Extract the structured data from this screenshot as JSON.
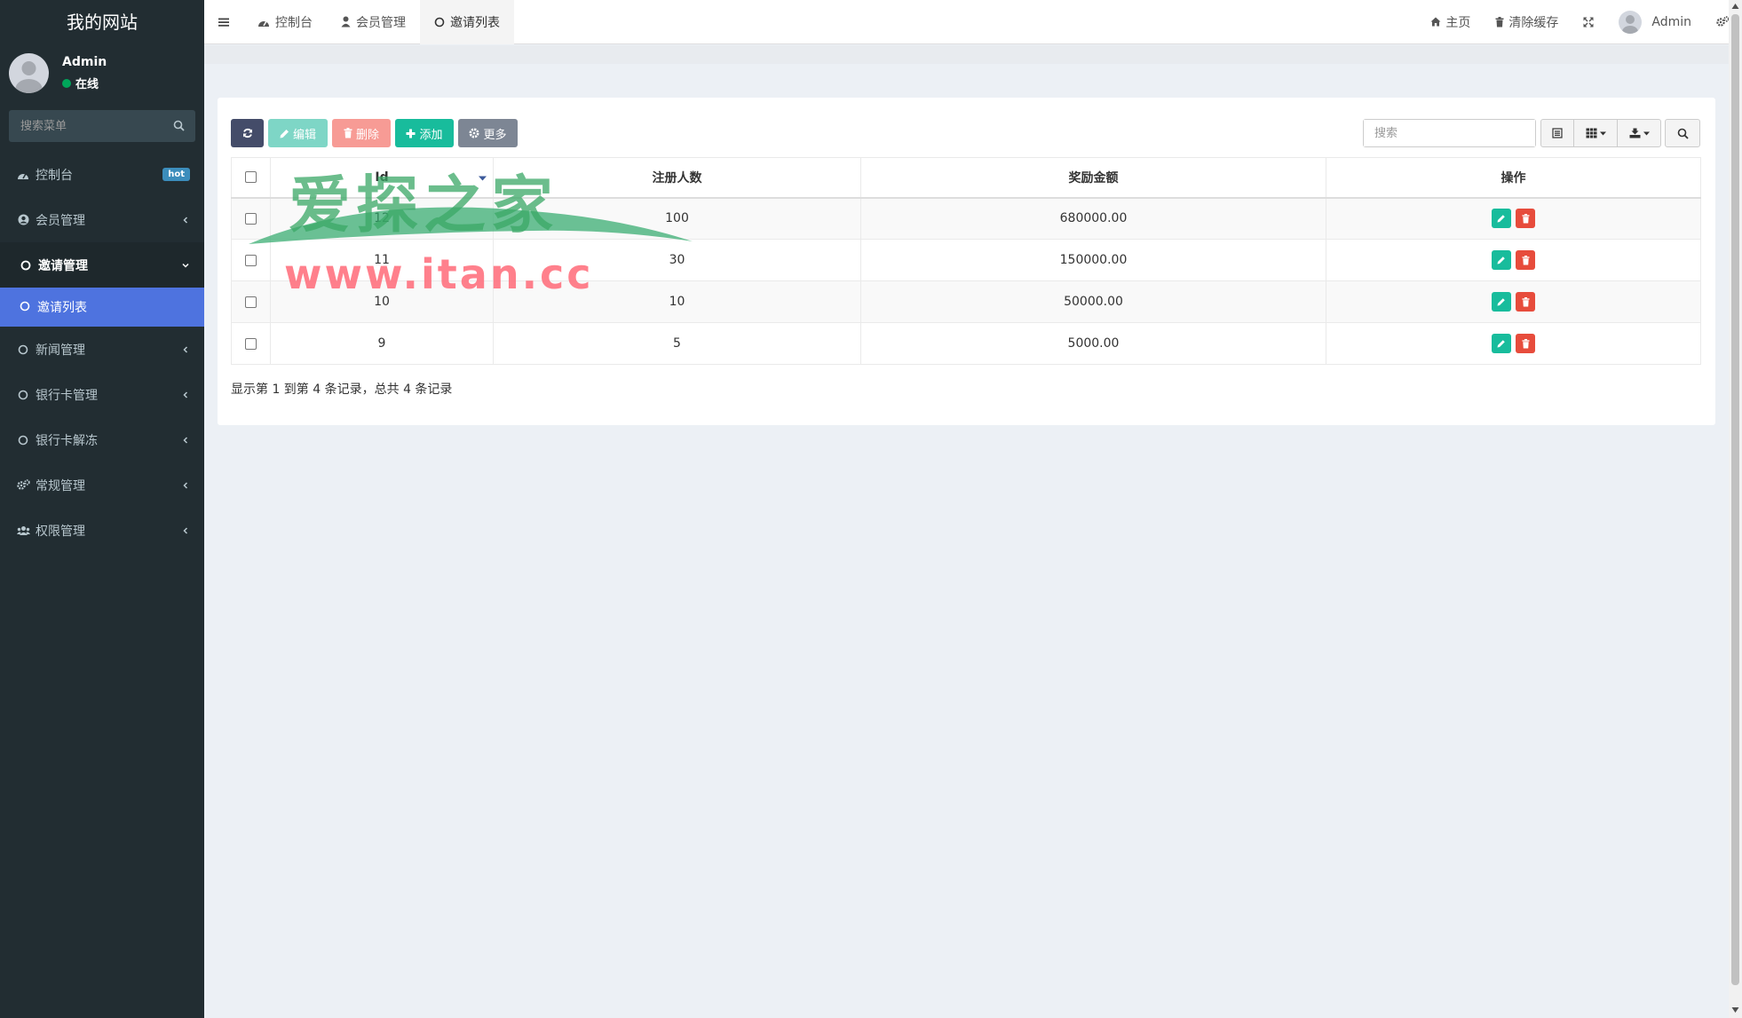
{
  "sidebar": {
    "logo": "我的网站",
    "user": {
      "name": "Admin",
      "status": "在线"
    },
    "search_placeholder": "搜索菜单",
    "items": [
      {
        "label": "控制台",
        "icon": "dashboard-icon",
        "badge": "hot"
      },
      {
        "label": "会员管理",
        "icon": "user-circle-icon"
      },
      {
        "label": "邀请管理",
        "icon": "circle-o-icon",
        "open": true
      },
      {
        "label": "新闻管理",
        "icon": "circle-o-icon"
      },
      {
        "label": "银行卡管理",
        "icon": "circle-o-icon"
      },
      {
        "label": "银行卡解冻",
        "icon": "circle-o-icon"
      },
      {
        "label": "常规管理",
        "icon": "cogs-icon"
      },
      {
        "label": "权限管理",
        "icon": "users-icon"
      }
    ],
    "submenu": {
      "label": "邀请列表",
      "icon": "circle-o-icon"
    }
  },
  "navbar": {
    "tabs": [
      {
        "label": "控制台",
        "icon": "dashboard-icon"
      },
      {
        "label": "会员管理",
        "icon": "user-icon"
      },
      {
        "label": "邀请列表",
        "icon": "circle-o-icon",
        "active": true
      }
    ],
    "home_label": "主页",
    "clear_cache_label": "清除缓存",
    "user_name": "Admin"
  },
  "toolbar": {
    "edit_label": "编辑",
    "delete_label": "删除",
    "add_label": "添加",
    "more_label": "更多",
    "search_placeholder": "搜索"
  },
  "table": {
    "columns": [
      "Id",
      "注册人数",
      "奖励金额",
      "操作"
    ],
    "rows": [
      {
        "id": "12",
        "count": "100",
        "amount": "680000.00"
      },
      {
        "id": "11",
        "count": "30",
        "amount": "150000.00"
      },
      {
        "id": "10",
        "count": "10",
        "amount": "50000.00"
      },
      {
        "id": "9",
        "count": "5",
        "amount": "5000.00"
      }
    ]
  },
  "pagination": {
    "info": "显示第 1 到第 4 条记录，总共 4 条记录"
  },
  "watermark": {
    "line1": "爱探之家",
    "line2": "www.itan.cc"
  },
  "colors": {
    "sidebar_bg": "#222d32",
    "active_submenu": "#4e73df",
    "success": "#18bc9c",
    "danger": "#e74c3c",
    "online": "#00a65a"
  }
}
